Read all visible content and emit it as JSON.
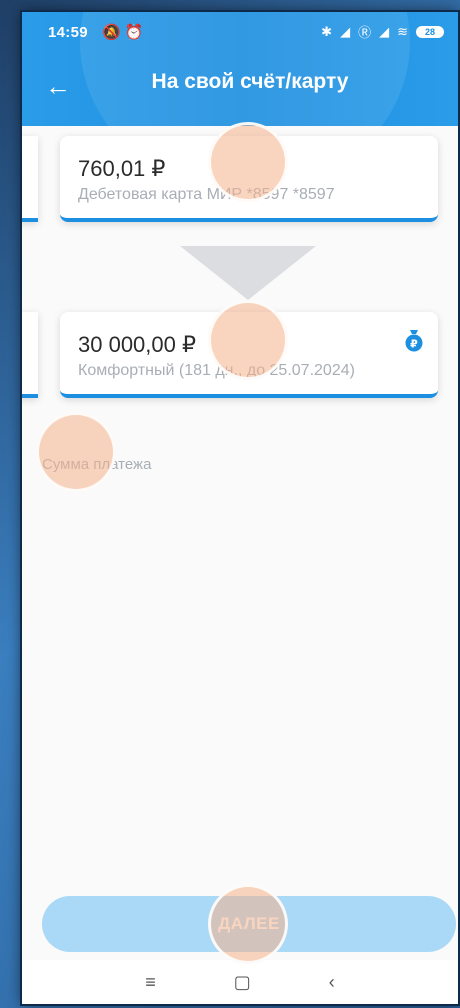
{
  "status_bar": {
    "time": "14:59",
    "left_icons": "🔕 ⏰",
    "right_icons": [
      "✱",
      "◢",
      "Ⓡ",
      "◢",
      "≋"
    ],
    "battery": "28"
  },
  "header": {
    "title": "На свой счёт/карту",
    "back_icon": "←"
  },
  "from_card": {
    "amount": "760,01 ₽",
    "description": "Дебетовая карта МИР *8597 *8597"
  },
  "to_card": {
    "amount": "30 000,00 ₽",
    "description": "Комфортный (181 дн., до 25.07.2024)",
    "icon": "moneybag-ruble-icon"
  },
  "payment": {
    "sum_label": "Сумма платежа"
  },
  "next_button": {
    "label": "ДАЛЕЕ"
  },
  "nav": {
    "menu": "≡",
    "home": "▢",
    "back": "‹"
  },
  "colors": {
    "accent": "#1d8fe0",
    "button_disabled": "#a9d9f6",
    "hint_text": "#a9aeb5"
  }
}
